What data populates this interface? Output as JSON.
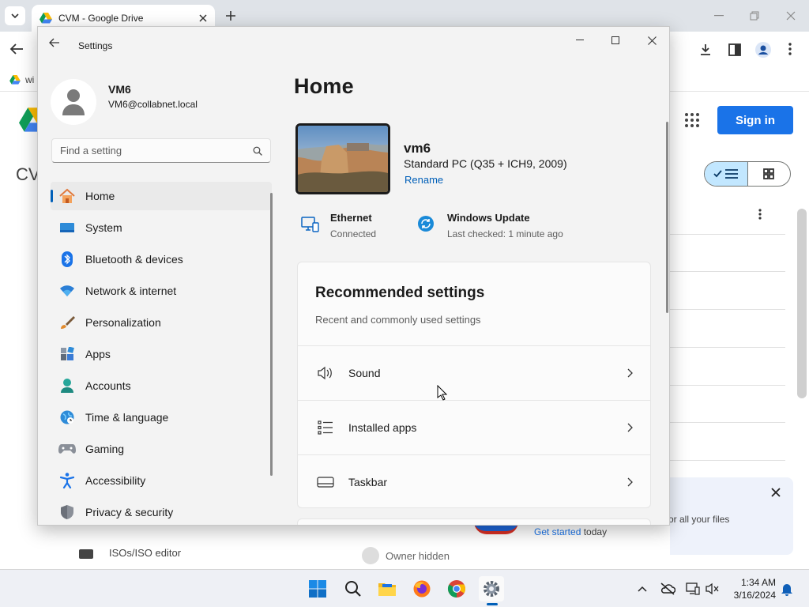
{
  "browser": {
    "tab_title": "CVM - Google Drive",
    "bookmark_label": "wi",
    "drive_title_partial": "CV",
    "signin_label": "Sign in",
    "promo_text": "or all your files",
    "promo_cta_link": "Get started",
    "promo_cta_rest": " today",
    "bg_row_name": "ISOs/ISO editor",
    "bg_row_owner": "Owner hidden"
  },
  "settings": {
    "window_title": "Settings",
    "user": {
      "name": "VM6",
      "email": "VM6@collabnet.local"
    },
    "search_placeholder": "Find a setting",
    "nav": [
      {
        "label": "Home",
        "icon": "home-icon",
        "active": true
      },
      {
        "label": "System",
        "icon": "system-icon"
      },
      {
        "label": "Bluetooth & devices",
        "icon": "bluetooth-icon"
      },
      {
        "label": "Network & internet",
        "icon": "network-icon"
      },
      {
        "label": "Personalization",
        "icon": "personalization-brush-icon"
      },
      {
        "label": "Apps",
        "icon": "apps-icon"
      },
      {
        "label": "Accounts",
        "icon": "accounts-icon"
      },
      {
        "label": "Time & language",
        "icon": "time-language-icon"
      },
      {
        "label": "Gaming",
        "icon": "gaming-icon"
      },
      {
        "label": "Accessibility",
        "icon": "accessibility-icon"
      },
      {
        "label": "Privacy & security",
        "icon": "privacy-shield-icon"
      }
    ],
    "home": {
      "heading": "Home",
      "pc_name": "vm6",
      "pc_spec": "Standard PC (Q35 + ICH9, 2009)",
      "rename_label": "Rename",
      "ethernet": {
        "title": "Ethernet",
        "status": "Connected"
      },
      "windows_update": {
        "title": "Windows Update",
        "status": "Last checked: 1 minute ago"
      },
      "recommended": {
        "title": "Recommended settings",
        "subtitle": "Recent and commonly used settings",
        "items": [
          {
            "label": "Sound",
            "icon": "speaker-icon"
          },
          {
            "label": "Installed apps",
            "icon": "installed-apps-list-icon"
          },
          {
            "label": "Taskbar",
            "icon": "taskbar-icon"
          }
        ]
      }
    }
  },
  "taskbar": {
    "time": "1:34 AM",
    "date": "3/16/2024"
  },
  "colors": {
    "accent": "#005fb8",
    "drive_blue": "#1a73e8"
  }
}
